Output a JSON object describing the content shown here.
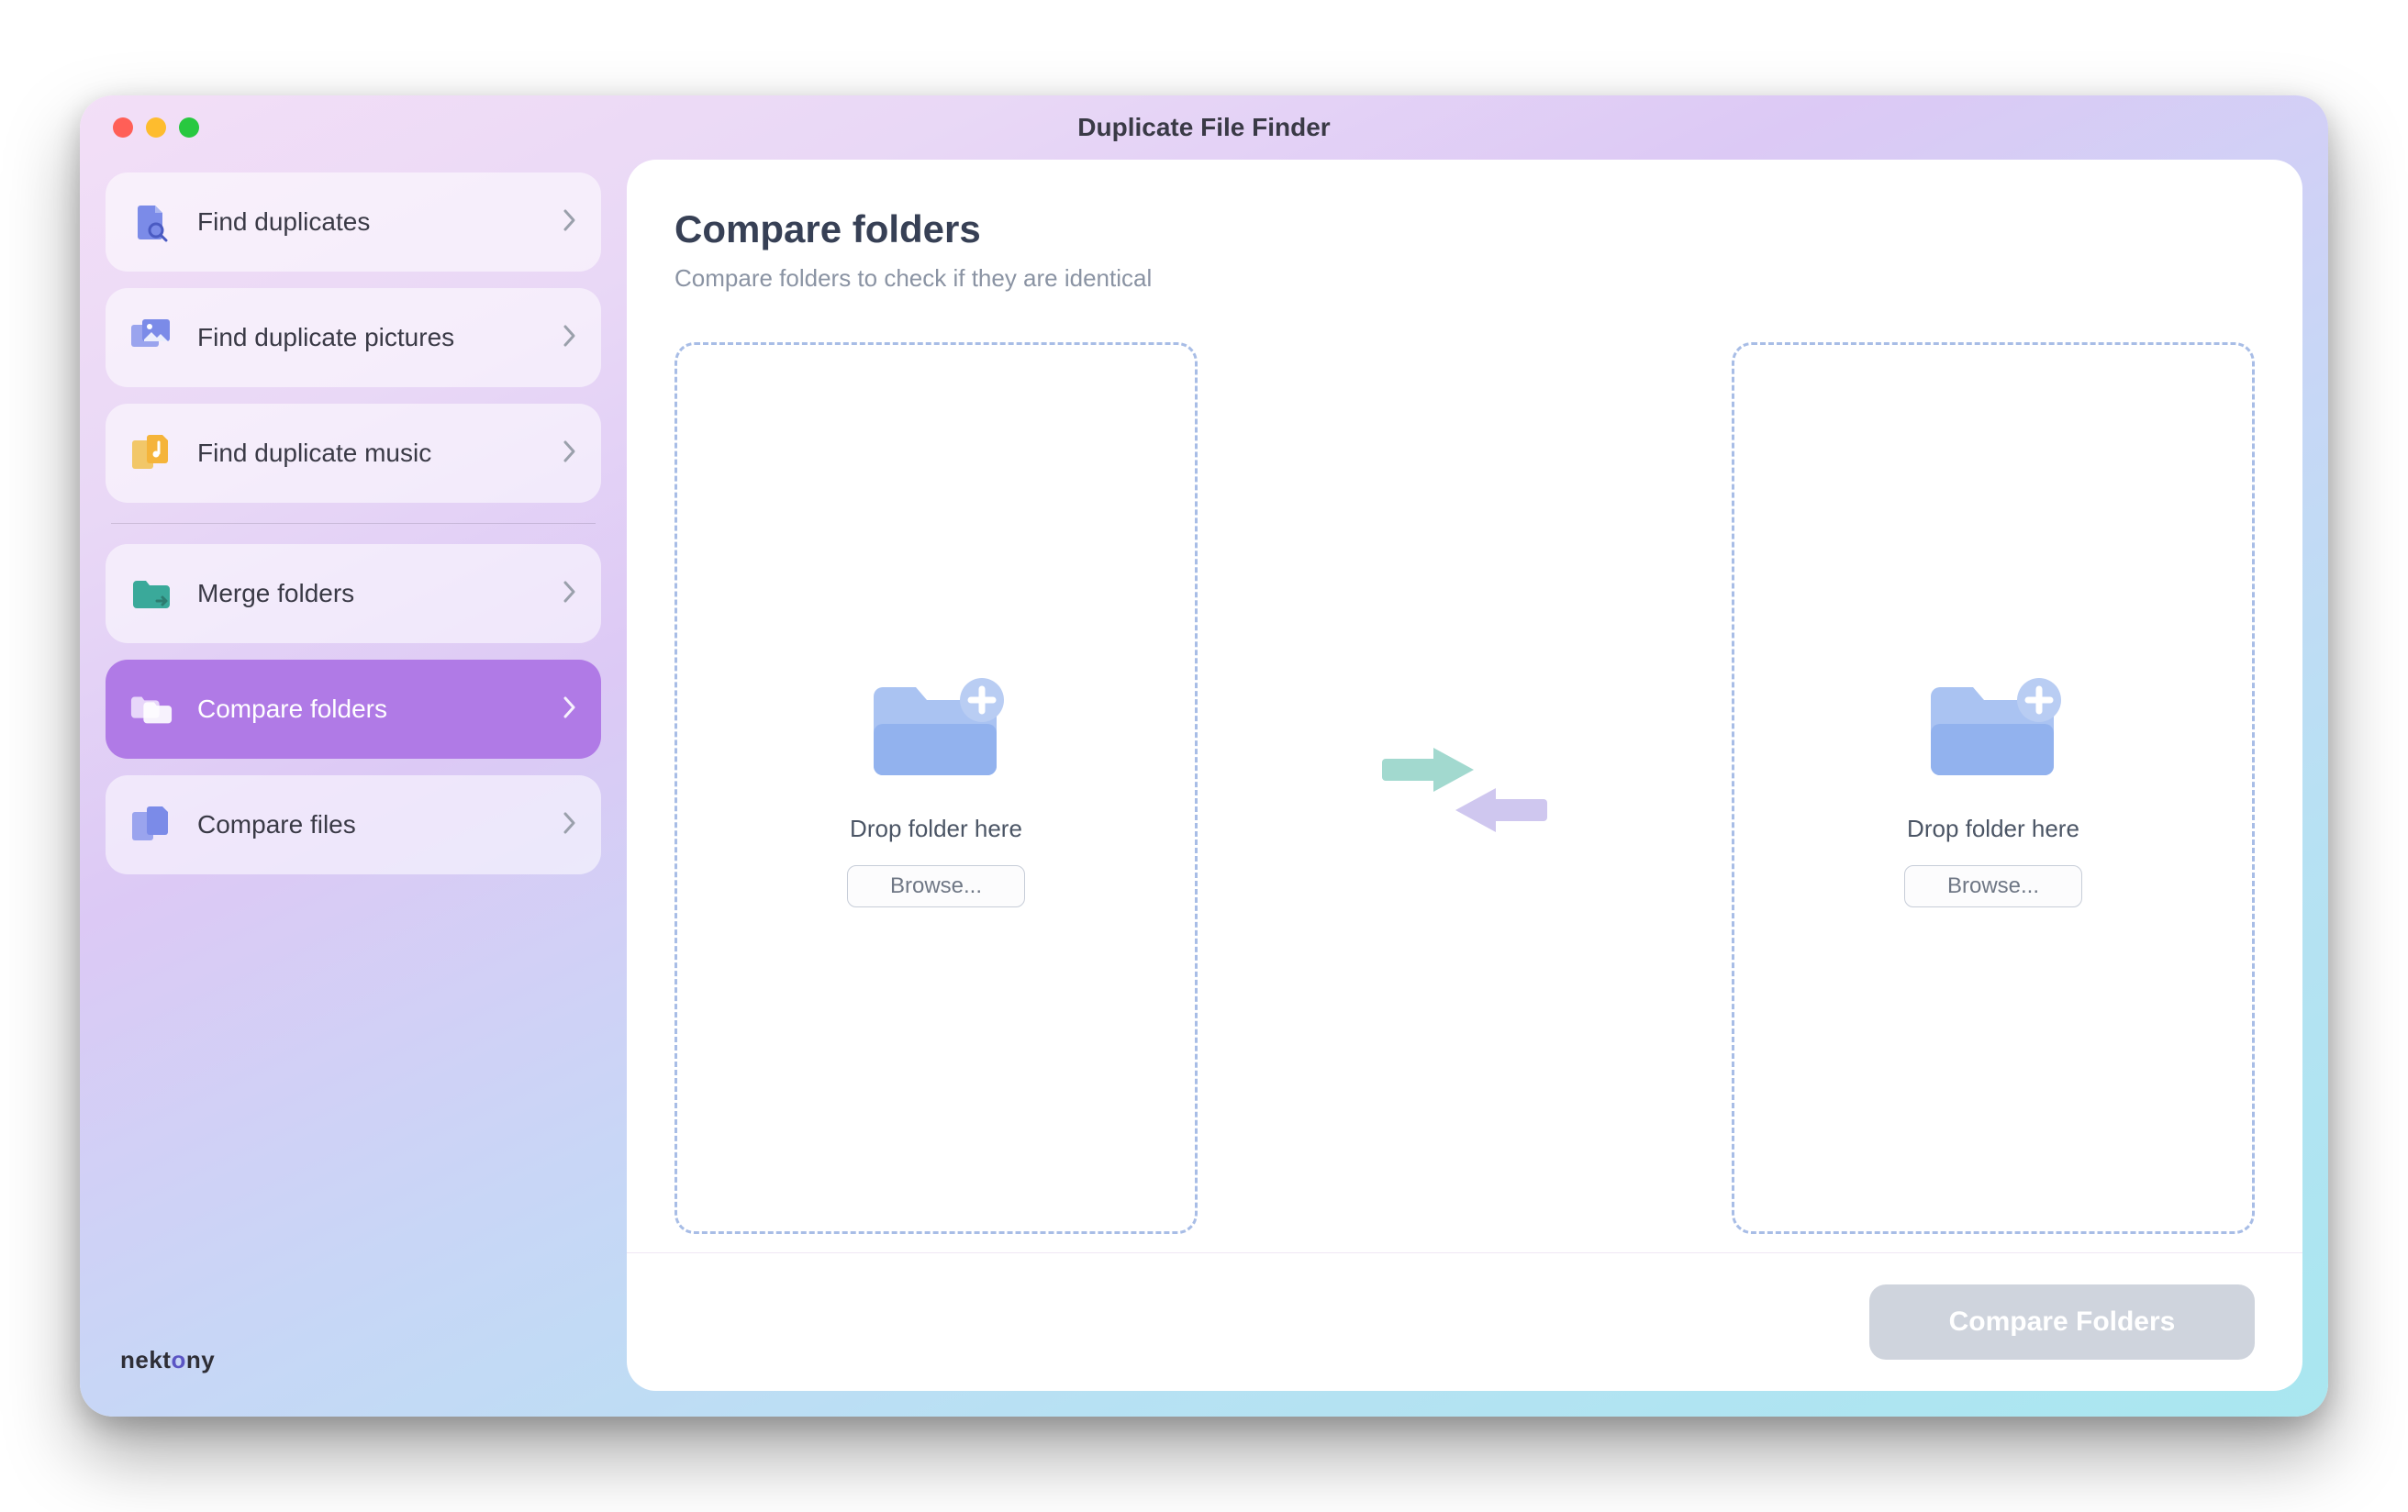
{
  "window": {
    "title": "Duplicate File Finder"
  },
  "sidebar": {
    "items": [
      {
        "label": "Find duplicates"
      },
      {
        "label": "Find duplicate pictures"
      },
      {
        "label": "Find duplicate music"
      },
      {
        "label": "Merge folders"
      },
      {
        "label": "Compare folders"
      },
      {
        "label": "Compare files"
      }
    ]
  },
  "brand": {
    "name": "nektony"
  },
  "main": {
    "title": "Compare folders",
    "subtitle": "Compare folders to check if they are identical",
    "dropzone": {
      "label": "Drop folder here",
      "browse": "Browse..."
    },
    "action": "Compare Folders"
  },
  "colors": {
    "accent": "#b07ae6",
    "dashed": "#a8bde6",
    "folderLight": "#aac3f2",
    "folderDark": "#7da2e8",
    "tealArrow": "#a2d9cf",
    "lilacArrow": "#cfc7ef"
  }
}
